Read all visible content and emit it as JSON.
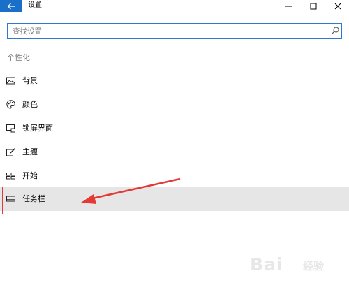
{
  "window": {
    "title": "设置",
    "back_icon": "arrow-left-icon",
    "controls": [
      "minimize-icon",
      "maximize-icon",
      "close-icon"
    ]
  },
  "search": {
    "placeholder": "查找设置",
    "icon": "search-icon"
  },
  "section": {
    "heading": "个性化"
  },
  "nav": {
    "items": [
      {
        "label": "背景",
        "icon": "picture-icon",
        "selected": false
      },
      {
        "label": "颜色",
        "icon": "palette-icon",
        "selected": false
      },
      {
        "label": "锁屏界面",
        "icon": "lock-screen-icon",
        "selected": false
      },
      {
        "label": "主题",
        "icon": "theme-brush-icon",
        "selected": false
      },
      {
        "label": "开始",
        "icon": "start-grid-icon",
        "selected": false
      },
      {
        "label": "任务栏",
        "icon": "taskbar-icon",
        "selected": true
      }
    ]
  },
  "annotation": {
    "highlight_color": "#e53935"
  },
  "watermark": {
    "text": "Bai",
    "subtext": "经验"
  },
  "colors": {
    "accent": "#1a6fc9",
    "selected_bg": "#e6e6e6"
  }
}
